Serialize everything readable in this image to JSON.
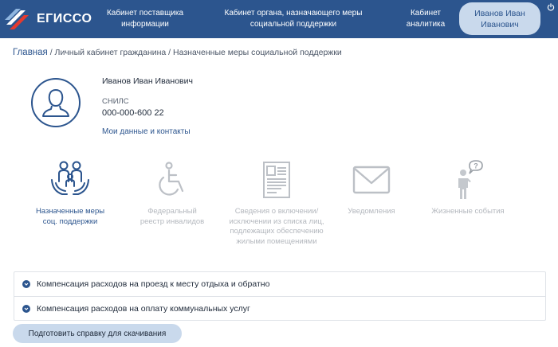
{
  "header": {
    "logo_text": "ЕГИССО",
    "nav": {
      "supplier": "Кабинет поставщика информации",
      "authority": "Кабинет органа, назначающего меры социальной поддержки",
      "analytics": "Кабинет аналитика",
      "user": "Иванов Иван Иванович"
    }
  },
  "breadcrumb": {
    "home": "Главная",
    "separator": " / ",
    "cabinet": "Личный кабинет гражданина",
    "current": "Назначенные меры социальной поддержки"
  },
  "profile": {
    "fullname": "Иванов Иван Иванович",
    "snils_label": "СНИЛС",
    "snils_value": "000-000-600 22",
    "my_data_link": "Мои данные и контакты"
  },
  "services": [
    {
      "label": "Назначенные меры соц. поддержки",
      "icon": "family-care-icon",
      "active": true
    },
    {
      "label": "Федеральный реестр инвалидов",
      "icon": "wheelchair-icon",
      "active": false
    },
    {
      "label": "Сведения о включении/исключении из списка лиц, подлежащих обеспечению жилыми помещениями",
      "icon": "document-icon",
      "active": false
    },
    {
      "label": "Уведомления",
      "icon": "envelope-icon",
      "active": false
    },
    {
      "label": "Жизненные события",
      "icon": "person-question-icon",
      "active": false
    }
  ],
  "accordion": [
    {
      "label": "Компенсация расходов на проезд к месту отдыха и обратно"
    },
    {
      "label": "Компенсация расходов на оплату коммунальных услуг"
    }
  ],
  "download_button": "Подготовить справку для скачивания",
  "colors": {
    "header": "#2c558e",
    "accent": "#2c558e",
    "pill": "#c9d9ec",
    "inactive": "#b4b8be"
  }
}
